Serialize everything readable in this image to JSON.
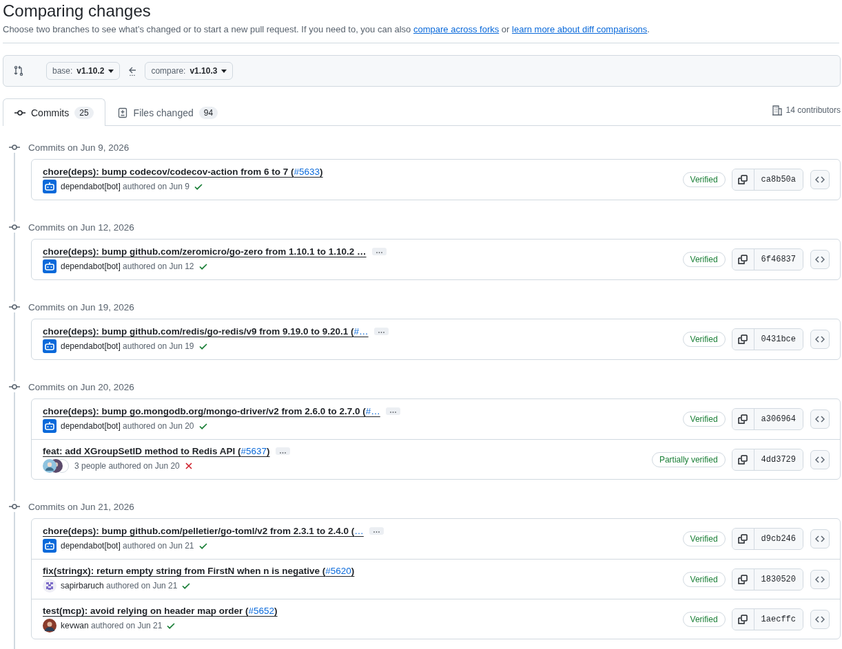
{
  "header": {
    "title": "Comparing changes",
    "description": "Choose two branches to see what’s changed or to start a new pull request. If you need to, you can also ",
    "links": [
      "compare across forks",
      "learn more about diff comparisons"
    ],
    "link_joiner": " or ",
    "end": "."
  },
  "compare": {
    "base_label": "base:",
    "base": "v1.10.2",
    "compare_label": "compare:",
    "compare": "v1.10.3"
  },
  "tabs": [
    {
      "label": "Commits",
      "count": "25",
      "kind": "commits",
      "selected": true
    },
    {
      "label": "Files changed",
      "count": "94",
      "kind": "files",
      "selected": false
    }
  ],
  "contributors": "14 contributors",
  "groups": [
    {
      "date": "Commits on Jun 9, 2026",
      "commits": [
        {
          "title": "chore(deps): bump codecov/codecov-action from 6 to 7 (",
          "pr": "#5633",
          "close": ")",
          "more": false,
          "avatar": {
            "kind": "bot"
          },
          "author": "dependabot[bot]",
          "meta": "authored on Jun 9",
          "checks_passed": true,
          "badge": "Verified",
          "sha": "ca8b50a"
        }
      ]
    },
    {
      "date": "Commits on Jun 12, 2026",
      "commits": [
        {
          "title": "chore(deps): bump github.com/zeromicro/go-zero from 1.10.1 to 1.10.2 …",
          "more": true,
          "avatar": {
            "kind": "bot"
          },
          "author": "dependabot[bot]",
          "meta": "authored on Jun 12",
          "checks_passed": true,
          "badge": "Verified",
          "sha": "6f46837"
        }
      ]
    },
    {
      "date": "Commits on Jun 19, 2026",
      "commits": [
        {
          "title": "chore(deps): bump github.com/redis/go-redis/v9 from 9.19.0 to 9.20.1 (",
          "pr": "#…",
          "more": true,
          "avatar": {
            "kind": "bot"
          },
          "author": "dependabot[bot]",
          "meta": "authored on Jun 19",
          "checks_passed": true,
          "badge": "Verified",
          "sha": "0431bce"
        }
      ]
    },
    {
      "date": "Commits on Jun 20, 2026",
      "commits": [
        {
          "title": "chore(deps): bump go.mongodb.org/mongo-driver/v2 from 2.6.0 to 2.7.0 (",
          "pr": "#…",
          "more": true,
          "avatar": {
            "kind": "bot"
          },
          "author": "dependabot[bot]",
          "meta": "authored on Jun 20",
          "checks_passed": true,
          "badge": "Verified",
          "sha": "a306964"
        },
        {
          "title": "feat: add XGroupSetID method to Redis API (",
          "pr": "#5637",
          "close": ")",
          "more": true,
          "avatar": {
            "kind": "group"
          },
          "meta": "3 people authored on Jun 20",
          "checks_passed": false,
          "badge": "Partially verified",
          "sha": "4dd3729"
        }
      ]
    },
    {
      "date": "Commits on Jun 21, 2026",
      "commits": [
        {
          "title": "chore(deps): bump github.com/pelletier/go-toml/v2 from 2.3.1 to 2.4.0 (",
          "pr": "…",
          "more": true,
          "avatar": {
            "kind": "bot"
          },
          "author": "dependabot[bot]",
          "meta": "authored on Jun 21",
          "checks_passed": true,
          "badge": "Verified",
          "sha": "d9cb246"
        },
        {
          "title": "fix(stringx): return empty string from FirstN when n is negative (",
          "pr": "#5620",
          "close": ")",
          "more": false,
          "avatar": {
            "kind": "identicon"
          },
          "author": "sapirbaruch",
          "meta": "authored on Jun 21",
          "checks_passed": true,
          "badge": "Verified",
          "sha": "1830520"
        },
        {
          "title": "test(mcp): avoid relying on header map order (",
          "pr": "#5652",
          "close": ")",
          "more": false,
          "avatar": {
            "kind": "photo"
          },
          "author": "kevwan",
          "meta": "authored on Jun 21",
          "checks_passed": true,
          "badge": "Verified",
          "sha": "1aecffc"
        }
      ]
    }
  ]
}
